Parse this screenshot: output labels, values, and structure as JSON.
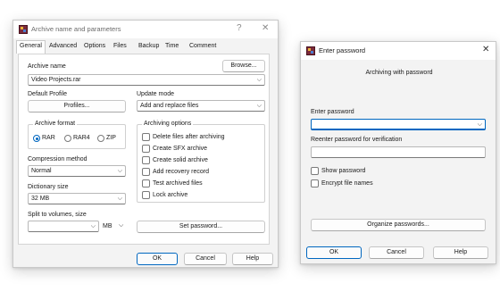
{
  "archive_dialog": {
    "title": "Archive name and parameters",
    "help_glyph": "?",
    "close_glyph": "✕",
    "tabs": [
      "General",
      "Advanced",
      "Options",
      "Files",
      "Backup",
      "Time",
      "Comment"
    ],
    "archive_name_label": "Archive name",
    "archive_name_value": "Video Projects.rar",
    "browse_label": "Browse...",
    "default_profile_label": "Default Profile",
    "profiles_label": "Profiles...",
    "update_mode_label": "Update mode",
    "update_mode_value": "Add and replace files",
    "archive_format_label": "Archive format",
    "formats": [
      "RAR",
      "RAR4",
      "ZIP"
    ],
    "selected_format": "RAR",
    "archiving_options_label": "Archiving options",
    "options": [
      "Delete files after archiving",
      "Create SFX archive",
      "Create solid archive",
      "Add recovery record",
      "Test archived files",
      "Lock archive"
    ],
    "compression_method_label": "Compression method",
    "compression_method_value": "Normal",
    "dictionary_size_label": "Dictionary size",
    "dictionary_size_value": "32 MB",
    "split_label": "Split to volumes, size",
    "split_unit": "MB",
    "set_password_label": "Set password...",
    "ok_label": "OK",
    "cancel_label": "Cancel",
    "help_label": "Help"
  },
  "password_dialog": {
    "title": "Enter password",
    "close_glyph": "✕",
    "subtitle": "Archiving with password",
    "enter_label": "Enter password",
    "reenter_label": "Reenter password for verification",
    "show_password_label": "Show password",
    "encrypt_names_label": "Encrypt file names",
    "organize_label": "Organize passwords...",
    "ok_label": "OK",
    "cancel_label": "Cancel",
    "help_label": "Help"
  },
  "icons": {
    "app_icon": "winrar-books-icon",
    "chevron": "chevron-down-icon",
    "chevron_glyph": "⌵"
  },
  "colors": {
    "accent": "#0067c0",
    "window_bg": "#f3f3f3"
  }
}
